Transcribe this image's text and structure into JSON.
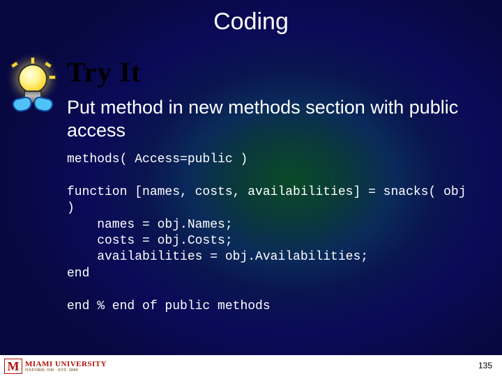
{
  "title": "Coding",
  "tryit": "Try It",
  "desc": "Put method in new methods section with public access",
  "code": "methods( Access=public )\n\nfunction [names, costs, availabilities] = snacks( obj\n)\n    names = obj.Names;\n    costs = obj.Costs;\n    availabilities = obj.Availabilities;\nend\n\nend % end of public methods",
  "logo": {
    "m": "M",
    "name": "MIAMI UNIVERSITY",
    "sub": "OXFORD, OH · EST. 1809"
  },
  "page": "135"
}
